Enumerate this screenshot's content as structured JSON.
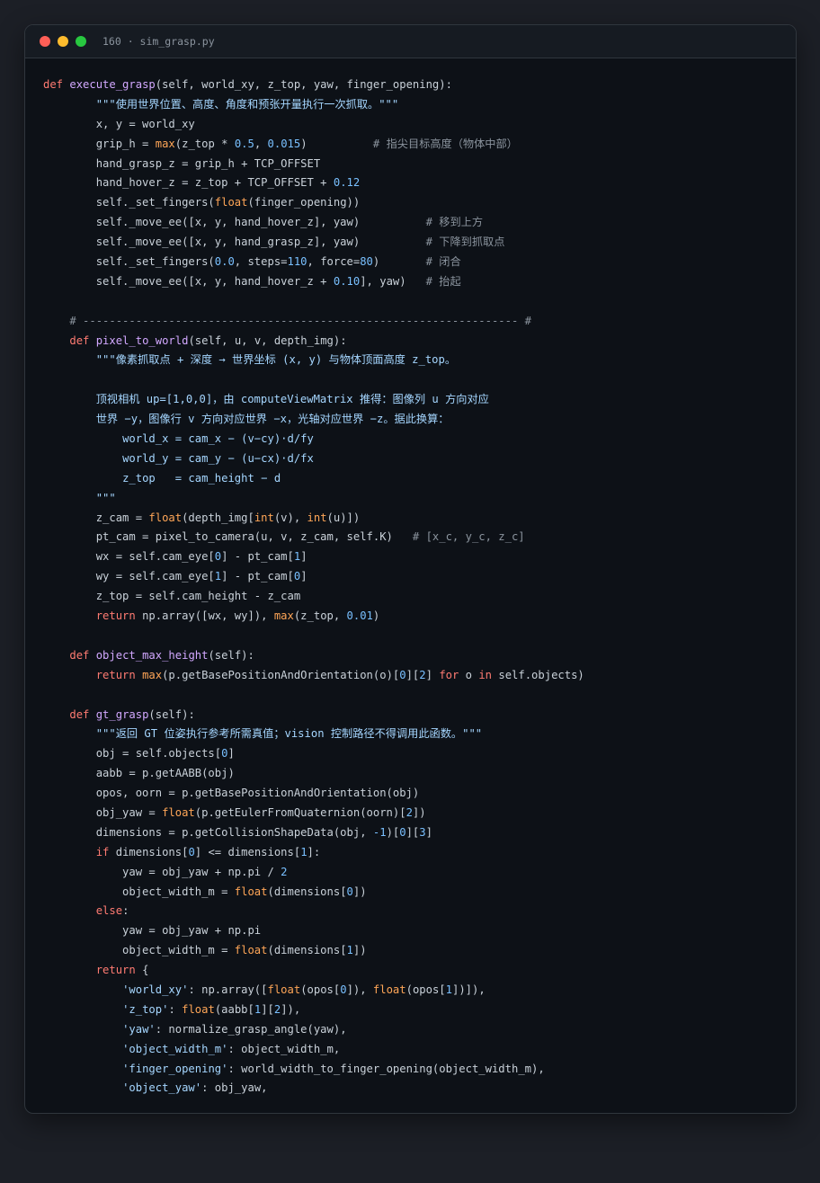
{
  "window": {
    "title": "160 · sim_grasp.py"
  },
  "colors": {
    "background": "#1c1f26",
    "editor": "#0d1117",
    "keyword": "#ff7b72",
    "function": "#d2a8ff",
    "builtin": "#ffa657",
    "number": "#79c0ff",
    "string": "#a5d6ff",
    "comment": "#8b949e",
    "text": "#c9d1d9"
  },
  "code_lines": [
    [
      [
        "kw",
        "def"
      ],
      [
        "t",
        " "
      ],
      [
        "fn",
        "execute_grasp"
      ],
      [
        "t",
        "(self, world_xy, z_top, yaw, finger_opening):"
      ]
    ],
    [
      [
        "t",
        "        "
      ],
      [
        "str",
        "\"\"\"使用世界位置、高度、角度和预张开量执行一次抓取。\"\"\""
      ]
    ],
    [
      [
        "t",
        "        x, y = world_xy"
      ]
    ],
    [
      [
        "t",
        "        grip_h = "
      ],
      [
        "bi",
        "max"
      ],
      [
        "t",
        "(z_top * "
      ],
      [
        "num",
        "0.5"
      ],
      [
        "t",
        ", "
      ],
      [
        "num",
        "0.015"
      ],
      [
        "t",
        ")          "
      ],
      [
        "cm",
        "# 指尖目标高度（物体中部）"
      ]
    ],
    [
      [
        "t",
        "        hand_grasp_z = grip_h + TCP_OFFSET"
      ]
    ],
    [
      [
        "t",
        "        hand_hover_z = z_top + TCP_OFFSET + "
      ],
      [
        "num",
        "0.12"
      ]
    ],
    [
      [
        "t",
        "        self._set_fingers("
      ],
      [
        "bi",
        "float"
      ],
      [
        "t",
        "(finger_opening))"
      ]
    ],
    [
      [
        "t",
        "        self._move_ee([x, y, hand_hover_z], yaw)          "
      ],
      [
        "cm",
        "# 移到上方"
      ]
    ],
    [
      [
        "t",
        "        self._move_ee([x, y, hand_grasp_z], yaw)          "
      ],
      [
        "cm",
        "# 下降到抓取点"
      ]
    ],
    [
      [
        "t",
        "        self._set_fingers("
      ],
      [
        "num",
        "0.0"
      ],
      [
        "t",
        ", steps="
      ],
      [
        "num",
        "110"
      ],
      [
        "t",
        ", force="
      ],
      [
        "num",
        "80"
      ],
      [
        "t",
        ")       "
      ],
      [
        "cm",
        "# 闭合"
      ]
    ],
    [
      [
        "t",
        "        self._move_ee([x, y, hand_hover_z + "
      ],
      [
        "num",
        "0.10"
      ],
      [
        "t",
        "], yaw)   "
      ],
      [
        "cm",
        "# 抬起"
      ]
    ],
    [],
    [
      [
        "t",
        "    "
      ],
      [
        "cm",
        "# ------------------------------------------------------------------ #"
      ]
    ],
    [
      [
        "t",
        "    "
      ],
      [
        "kw",
        "def"
      ],
      [
        "t",
        " "
      ],
      [
        "fn",
        "pixel_to_world"
      ],
      [
        "t",
        "(self, u, v, depth_img):"
      ]
    ],
    [
      [
        "t",
        "        "
      ],
      [
        "str",
        "\"\"\"像素抓取点 + 深度 → 世界坐标 (x, y) 与物体顶面高度 z_top。"
      ]
    ],
    [],
    [
      [
        "t",
        "        "
      ],
      [
        "str",
        "顶视相机 up=[1,0,0]，由 computeViewMatrix 推得：图像列 u 方向对应"
      ]
    ],
    [
      [
        "t",
        "        "
      ],
      [
        "str",
        "世界 −y，图像行 v 方向对应世界 −x，光轴对应世界 −z。据此换算："
      ]
    ],
    [
      [
        "t",
        "            "
      ],
      [
        "str",
        "world_x = cam_x − (v−cy)·d/fy"
      ]
    ],
    [
      [
        "t",
        "            "
      ],
      [
        "str",
        "world_y = cam_y − (u−cx)·d/fx"
      ]
    ],
    [
      [
        "t",
        "            "
      ],
      [
        "str",
        "z_top   = cam_height − d"
      ]
    ],
    [
      [
        "t",
        "        "
      ],
      [
        "str",
        "\"\"\""
      ]
    ],
    [
      [
        "t",
        "        z_cam = "
      ],
      [
        "bi",
        "float"
      ],
      [
        "t",
        "(depth_img["
      ],
      [
        "bi",
        "int"
      ],
      [
        "t",
        "(v), "
      ],
      [
        "bi",
        "int"
      ],
      [
        "t",
        "(u)])"
      ]
    ],
    [
      [
        "t",
        "        pt_cam = pixel_to_camera(u, v, z_cam, self.K)   "
      ],
      [
        "cm",
        "# [x_c, y_c, z_c]"
      ]
    ],
    [
      [
        "t",
        "        wx = self.cam_eye["
      ],
      [
        "num",
        "0"
      ],
      [
        "t",
        "] - pt_cam["
      ],
      [
        "num",
        "1"
      ],
      [
        "t",
        "]"
      ]
    ],
    [
      [
        "t",
        "        wy = self.cam_eye["
      ],
      [
        "num",
        "1"
      ],
      [
        "t",
        "] - pt_cam["
      ],
      [
        "num",
        "0"
      ],
      [
        "t",
        "]"
      ]
    ],
    [
      [
        "t",
        "        z_top = self.cam_height - z_cam"
      ]
    ],
    [
      [
        "t",
        "        "
      ],
      [
        "kw",
        "return"
      ],
      [
        "t",
        " np.array([wx, wy]), "
      ],
      [
        "bi",
        "max"
      ],
      [
        "t",
        "(z_top, "
      ],
      [
        "num",
        "0.01"
      ],
      [
        "t",
        ")"
      ]
    ],
    [],
    [
      [
        "t",
        "    "
      ],
      [
        "kw",
        "def"
      ],
      [
        "t",
        " "
      ],
      [
        "fn",
        "object_max_height"
      ],
      [
        "t",
        "(self):"
      ]
    ],
    [
      [
        "t",
        "        "
      ],
      [
        "kw",
        "return"
      ],
      [
        "t",
        " "
      ],
      [
        "bi",
        "max"
      ],
      [
        "t",
        "(p.getBasePositionAndOrientation(o)["
      ],
      [
        "num",
        "0"
      ],
      [
        "t",
        "]["
      ],
      [
        "num",
        "2"
      ],
      [
        "t",
        "] "
      ],
      [
        "kw",
        "for"
      ],
      [
        "t",
        " o "
      ],
      [
        "kw",
        "in"
      ],
      [
        "t",
        " self.objects)"
      ]
    ],
    [],
    [
      [
        "t",
        "    "
      ],
      [
        "kw",
        "def"
      ],
      [
        "t",
        " "
      ],
      [
        "fn",
        "gt_grasp"
      ],
      [
        "t",
        "(self):"
      ]
    ],
    [
      [
        "t",
        "        "
      ],
      [
        "str",
        "\"\"\"返回 GT 位姿执行参考所需真值；vision 控制路径不得调用此函数。\"\"\""
      ]
    ],
    [
      [
        "t",
        "        obj = self.objects["
      ],
      [
        "num",
        "0"
      ],
      [
        "t",
        "]"
      ]
    ],
    [
      [
        "t",
        "        aabb = p.getAABB(obj)"
      ]
    ],
    [
      [
        "t",
        "        opos, oorn = p.getBasePositionAndOrientation(obj)"
      ]
    ],
    [
      [
        "t",
        "        obj_yaw = "
      ],
      [
        "bi",
        "float"
      ],
      [
        "t",
        "(p.getEulerFromQuaternion(oorn)["
      ],
      [
        "num",
        "2"
      ],
      [
        "t",
        "])"
      ]
    ],
    [
      [
        "t",
        "        dimensions = p.getCollisionShapeData(obj, "
      ],
      [
        "num",
        "-1"
      ],
      [
        "t",
        ")["
      ],
      [
        "num",
        "0"
      ],
      [
        "t",
        "]["
      ],
      [
        "num",
        "3"
      ],
      [
        "t",
        "]"
      ]
    ],
    [
      [
        "t",
        "        "
      ],
      [
        "kw",
        "if"
      ],
      [
        "t",
        " dimensions["
      ],
      [
        "num",
        "0"
      ],
      [
        "t",
        "] <= dimensions["
      ],
      [
        "num",
        "1"
      ],
      [
        "t",
        "]:"
      ]
    ],
    [
      [
        "t",
        "            yaw = obj_yaw + np.pi / "
      ],
      [
        "num",
        "2"
      ]
    ],
    [
      [
        "t",
        "            object_width_m = "
      ],
      [
        "bi",
        "float"
      ],
      [
        "t",
        "(dimensions["
      ],
      [
        "num",
        "0"
      ],
      [
        "t",
        "])"
      ]
    ],
    [
      [
        "t",
        "        "
      ],
      [
        "kw",
        "else"
      ],
      [
        "t",
        ":"
      ]
    ],
    [
      [
        "t",
        "            yaw = obj_yaw + np.pi"
      ]
    ],
    [
      [
        "t",
        "            object_width_m = "
      ],
      [
        "bi",
        "float"
      ],
      [
        "t",
        "(dimensions["
      ],
      [
        "num",
        "1"
      ],
      [
        "t",
        "])"
      ]
    ],
    [
      [
        "t",
        "        "
      ],
      [
        "kw",
        "return"
      ],
      [
        "t",
        " {"
      ]
    ],
    [
      [
        "t",
        "            "
      ],
      [
        "str",
        "'world_xy'"
      ],
      [
        "t",
        ": np.array(["
      ],
      [
        "bi",
        "float"
      ],
      [
        "t",
        "(opos["
      ],
      [
        "num",
        "0"
      ],
      [
        "t",
        "]), "
      ],
      [
        "bi",
        "float"
      ],
      [
        "t",
        "(opos["
      ],
      [
        "num",
        "1"
      ],
      [
        "t",
        "])]),"
      ]
    ],
    [
      [
        "t",
        "            "
      ],
      [
        "str",
        "'z_top'"
      ],
      [
        "t",
        ": "
      ],
      [
        "bi",
        "float"
      ],
      [
        "t",
        "(aabb["
      ],
      [
        "num",
        "1"
      ],
      [
        "t",
        "]["
      ],
      [
        "num",
        "2"
      ],
      [
        "t",
        "]),"
      ]
    ],
    [
      [
        "t",
        "            "
      ],
      [
        "str",
        "'yaw'"
      ],
      [
        "t",
        ": normalize_grasp_angle(yaw),"
      ]
    ],
    [
      [
        "t",
        "            "
      ],
      [
        "str",
        "'object_width_m'"
      ],
      [
        "t",
        ": object_width_m,"
      ]
    ],
    [
      [
        "t",
        "            "
      ],
      [
        "str",
        "'finger_opening'"
      ],
      [
        "t",
        ": world_width_to_finger_opening(object_width_m),"
      ]
    ],
    [
      [
        "t",
        "            "
      ],
      [
        "str",
        "'object_yaw'"
      ],
      [
        "t",
        ": obj_yaw,"
      ]
    ]
  ]
}
